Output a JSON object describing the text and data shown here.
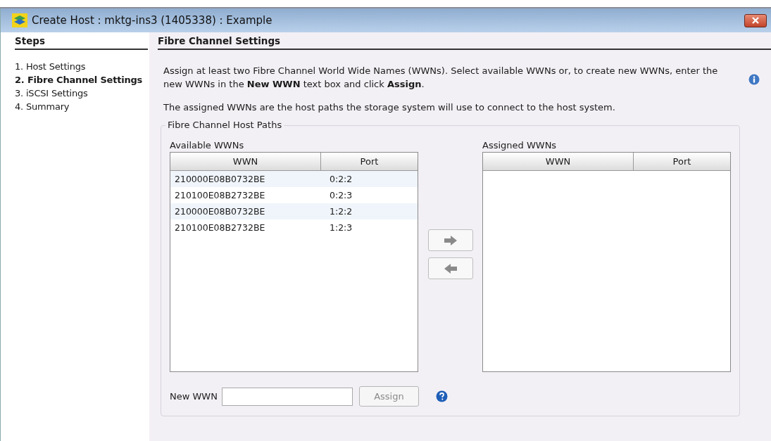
{
  "window": {
    "title": "Create Host : mktg-ins3 (1405338) : Example"
  },
  "steps": {
    "heading": "Steps",
    "items": [
      {
        "label": "1. Host Settings",
        "selected": false
      },
      {
        "label": "2. Fibre Channel Settings",
        "selected": true
      },
      {
        "label": "3. iSCSI Settings",
        "selected": false
      },
      {
        "label": "4. Summary",
        "selected": false
      }
    ]
  },
  "page": {
    "heading": "Fibre Channel Settings",
    "intro": "Assign at least two Fibre Channel World Wide Names (WWNs). Select available WWNs or, to create new WWNs, enter the new WWNs in the **New WWN** text box and click **Assign**.",
    "note": "The assigned WWNs are the host paths the storage system will use to connect to the host system.",
    "group_title": "Fibre Channel Host Paths",
    "available": {
      "label": "Available WWNs",
      "columns": [
        "WWN",
        "Port"
      ],
      "rows": [
        [
          "210000E08B0732BE",
          "0:2:2"
        ],
        [
          "210100E08B2732BE",
          "0:2:3"
        ],
        [
          "210000E08B0732BE",
          "1:2:2"
        ],
        [
          "210100E08B2732BE",
          "1:2:3"
        ]
      ]
    },
    "assigned": {
      "label": "Assigned WWNs",
      "columns": [
        "WWN",
        "Port"
      ]
    },
    "new_wwn": {
      "label": "New WWN"
    },
    "assign_button": {
      "label": "Assign",
      "disabled": true
    }
  }
}
